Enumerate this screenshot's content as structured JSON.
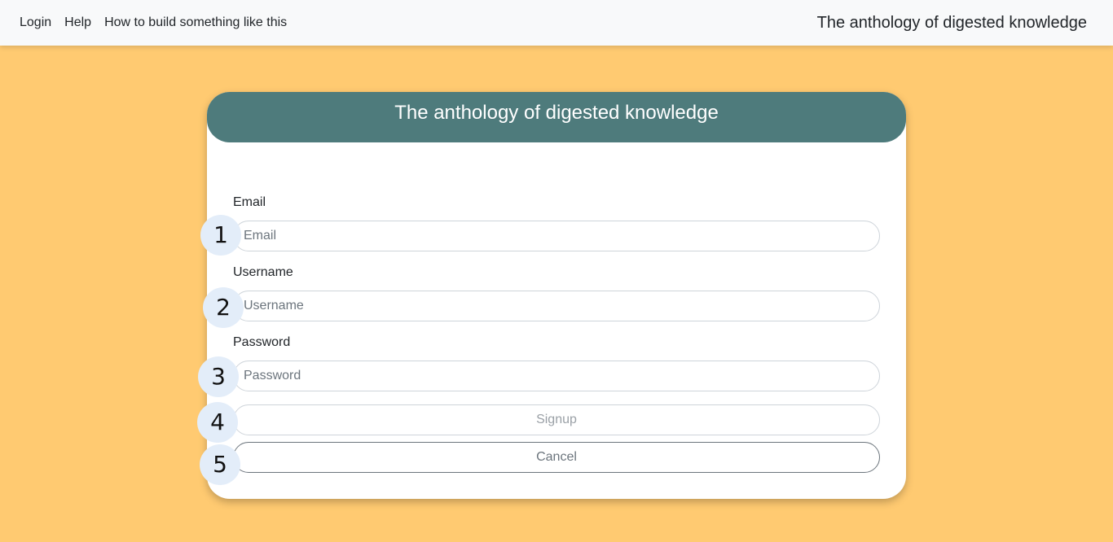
{
  "navbar": {
    "links": [
      {
        "label": "Login"
      },
      {
        "label": "Help"
      },
      {
        "label": "How to build something like this"
      }
    ],
    "brand": "The anthology of digested knowledge"
  },
  "card": {
    "title": "The anthology of digested knowledge",
    "fields": {
      "email": {
        "label": "Email",
        "placeholder": "Email",
        "value": ""
      },
      "username": {
        "label": "Username",
        "placeholder": "Username",
        "value": ""
      },
      "password": {
        "label": "Password",
        "placeholder": "Password",
        "value": ""
      }
    },
    "buttons": {
      "signup": "Signup",
      "cancel": "Cancel"
    }
  },
  "markers": [
    "1",
    "2",
    "3",
    "4",
    "5"
  ],
  "colors": {
    "background": "#ffca71",
    "header": "#4e7b7c",
    "marker": "#e3edf9"
  }
}
